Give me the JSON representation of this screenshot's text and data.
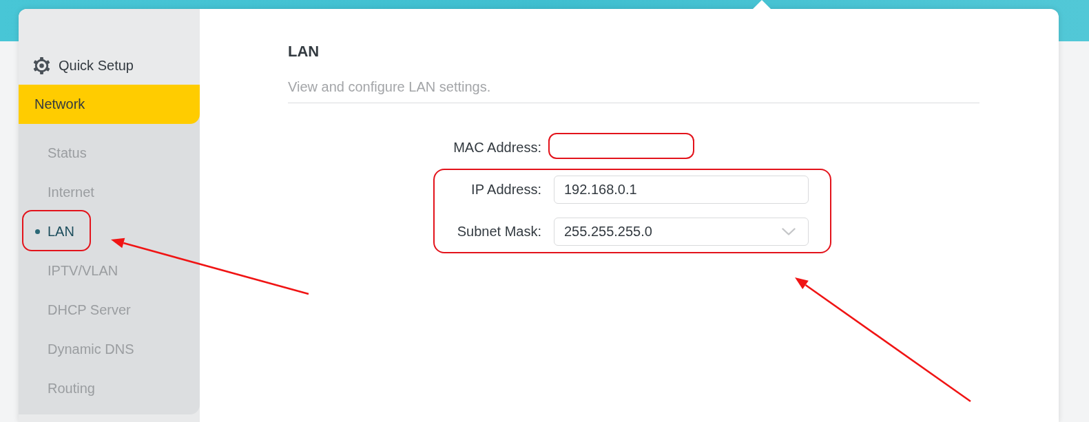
{
  "sidebar": {
    "items": [
      {
        "kind": "link",
        "label": "Quick Setup",
        "selected": false
      },
      {
        "kind": "section",
        "label": "Network",
        "selected": true,
        "expanded": true,
        "children": [
          {
            "label": "Status",
            "selected": false
          },
          {
            "label": "Internet",
            "selected": false
          },
          {
            "label": "LAN",
            "selected": true
          },
          {
            "label": "IPTV/VLAN",
            "selected": false
          },
          {
            "label": "DHCP Server",
            "selected": false
          },
          {
            "label": "Dynamic DNS",
            "selected": false
          },
          {
            "label": "Routing",
            "selected": false
          }
        ]
      }
    ]
  },
  "page": {
    "title": "LAN",
    "subtitle": "View and configure LAN settings.",
    "fields": [
      {
        "kind": "text",
        "label": "MAC Address:"
      },
      {
        "kind": "input",
        "label": "IP Address:",
        "value": "192.168.0.1"
      },
      {
        "kind": "select",
        "label": "Subnet Mask:",
        "value": "255.255.255.0"
      }
    ]
  }
}
